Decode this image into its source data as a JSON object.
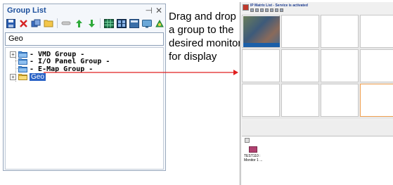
{
  "group_list": {
    "title": "Group List",
    "pin_glyph": "⊣",
    "close_glyph": "✕",
    "search_value": "Geo",
    "toolbar_icons": [
      "save-icon",
      "delete-icon",
      "copy-icon",
      "folder-icon",
      "link-icon",
      "move-up-icon",
      "move-down-icon",
      "grid-icon",
      "monitor-wall-icon",
      "layout-icon",
      "screen-icon",
      "settings-icon"
    ],
    "tree": {
      "vmd": "- VMD Group -",
      "io": "- I/O Panel Group -",
      "emap": "- E-Map Group -",
      "geo": "Geo"
    }
  },
  "instruction": {
    "line1": "Drag and drop",
    "line2": "a group to the",
    "line3": "desired monitor",
    "line4": "for display"
  },
  "ip_matrix": {
    "title": "IP Matrix List - Service is activated",
    "monitor_label": "TEST110 : Monitor 1 ..."
  },
  "colors": {
    "accent": "#1c4f9c",
    "arrow": "#e02020",
    "selection": "#2b63c6"
  }
}
